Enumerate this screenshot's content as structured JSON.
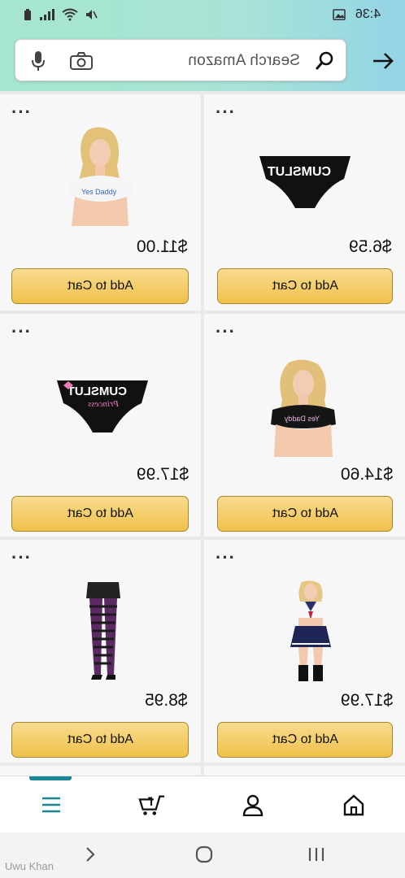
{
  "status_bar": {
    "time": "4:36"
  },
  "search": {
    "placeholder_text": "Search Amazon"
  },
  "products": [
    {
      "price": "$11.00",
      "cart_label": "Add to Cart",
      "item": "white crop top and underwear"
    },
    {
      "price": "$6.59",
      "cart_label": "Add to Cart",
      "item": "black CUMSLUT briefs"
    },
    {
      "price": "$17.99",
      "cart_label": "Add to Cart",
      "item": "black CUMSLUT Princess briefs"
    },
    {
      "price": "$14.60",
      "cart_label": "Add to Cart",
      "item": "black crop top"
    },
    {
      "price": "$8.95",
      "cart_label": "Add to Cart",
      "item": "striped stockings and skirt"
    },
    {
      "price": "$17.99",
      "cart_label": "Add to Cart",
      "item": "sailor uniform costume"
    }
  ],
  "brief_text": {
    "a": "CUMSLUT",
    "b": "CUMSLUT",
    "b2": "Princess"
  },
  "top_text": {
    "a": "Yes Daddy",
    "b": "Yes Daddy"
  },
  "watermark": "Uwu Khan",
  "icons": [
    "mic-icon",
    "camera-icon",
    "search-icon",
    "arrow-right-icon",
    "menu-icon",
    "cart-icon",
    "account-icon",
    "home-icon",
    "back-icon",
    "home-circle-icon",
    "recents-icon"
  ],
  "colors": {
    "cart_button": "#f0c14b",
    "accent_teal": "#1a8797"
  }
}
